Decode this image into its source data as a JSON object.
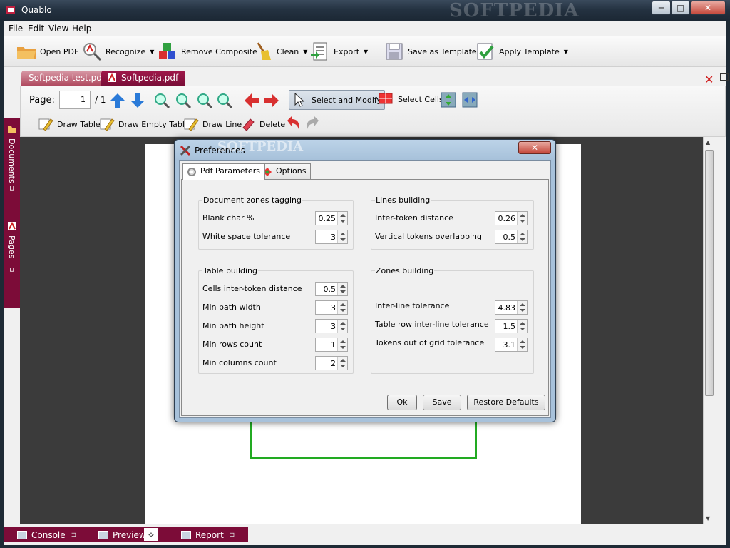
{
  "window": {
    "title": "Quablo",
    "watermark": "SOFTPEDIA",
    "min_glyph": "─",
    "max_glyph": "□",
    "close_glyph": "✕"
  },
  "menu": [
    "File",
    "Edit",
    "View",
    "Help"
  ],
  "toolbar": {
    "open_pdf": "Open PDF",
    "recognize": "Recognize",
    "remove_composite": "Remove Composite",
    "clean": "Clean",
    "export": "Export",
    "save_template": "Save as Template",
    "apply_template": "Apply Template",
    "dropdown_glyph": "▼"
  },
  "tabs": [
    {
      "label": "Softpedia test.pdf",
      "active": false
    },
    {
      "label": "Softpedia.pdf",
      "active": true
    }
  ],
  "tab_close_glyph": "✕",
  "pagebar": {
    "page_label": "Page:",
    "page_value": "1",
    "page_total": "/ 1",
    "select_modify": "Select and Modify",
    "select_cells": "Select Cells",
    "draw_table": "Draw Table",
    "draw_empty_table": "Draw Empty Table",
    "draw_line": "Draw Line",
    "delete": "Delete"
  },
  "side": {
    "documents": "Documents",
    "pages": "Pages"
  },
  "bottom": {
    "console": "Console",
    "preview": "Preview",
    "report": "Report",
    "pin_glyph": "⊐",
    "selected_glyph": "⟡"
  },
  "dialog": {
    "title": "Preferences",
    "watermark": "SOFTPEDIA",
    "close_glyph": "✕",
    "tabs": {
      "pdf_params": "Pdf Parameters",
      "options": "Options"
    },
    "doc_zones": {
      "title": "Document zones tagging",
      "blank_char_label": "Blank char %",
      "blank_char": "0.25",
      "white_space_label": "White space tolerance",
      "white_space": "3"
    },
    "lines": {
      "title": "Lines building",
      "inter_token_label": "Inter-token distance",
      "inter_token": "0.26",
      "vertical_label": "Vertical tokens overlapping",
      "vertical": "0.5"
    },
    "table": {
      "title": "Table building",
      "cells_inter_label": "Cells inter-token distance",
      "cells_inter": "0.5",
      "min_path_width_label": "Min path width",
      "min_path_width": "3",
      "min_path_height_label": "Min path height",
      "min_path_height": "3",
      "min_rows_label": "Min rows count",
      "min_rows": "1",
      "min_cols_label": "Min columns count",
      "min_cols": "2"
    },
    "zones": {
      "title": "Zones building",
      "inter_line_label": "Inter-line tolerance",
      "inter_line": "4.83",
      "table_row_label": "Table row inter-line tolerance",
      "table_row": "1.5",
      "tokens_grid_label": "Tokens out of grid tolerance",
      "tokens_grid": "3.1"
    },
    "buttons": {
      "ok": "Ok",
      "save": "Save",
      "restore": "Restore Defaults"
    }
  },
  "colors": {
    "accent": "#7c0c38",
    "title_bar": "#243241",
    "doc_bg": "#3b3b3b",
    "table_line": "#22aa22"
  }
}
